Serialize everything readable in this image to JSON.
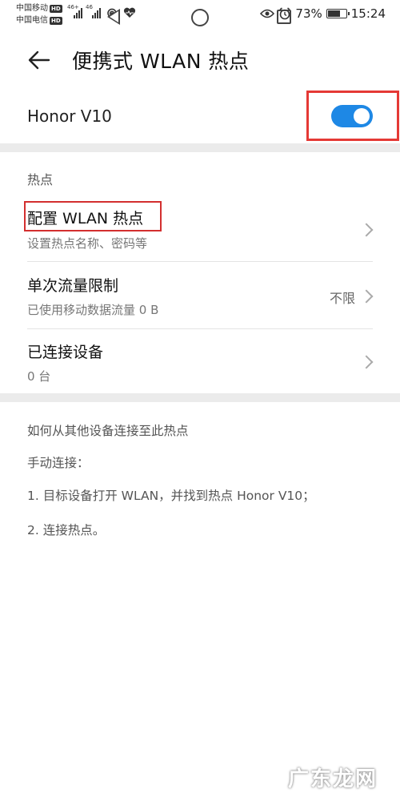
{
  "status_bar": {
    "carrier1": "中国移动",
    "carrier2": "中国电信",
    "hd": "HD",
    "net1": "46+",
    "net2": "46",
    "battery_percent": "73%",
    "battery_level": 0.73,
    "time": "15:24"
  },
  "header": {
    "title": "便携式 WLAN 热点"
  },
  "hotspot": {
    "device_name": "Honor V10",
    "enabled": true,
    "accent_color": "#1e88e5",
    "highlight_color": "#e53935"
  },
  "section": {
    "label": "热点"
  },
  "items": [
    {
      "title": "配置 WLAN 热点",
      "subtitle": "设置热点名称、密码等",
      "value": ""
    },
    {
      "title": "单次流量限制",
      "subtitle": "已使用移动数据流量 0 B",
      "value": "不限"
    },
    {
      "title": "已连接设备",
      "subtitle": "0 台",
      "value": ""
    }
  ],
  "help": {
    "heading": "如何从其他设备连接至此热点",
    "manual": "手动连接：",
    "step1": "1. 目标设备打开 WLAN，并找到热点 Honor V10；",
    "step2": "2. 连接热点。"
  },
  "watermark": "广东龙网"
}
